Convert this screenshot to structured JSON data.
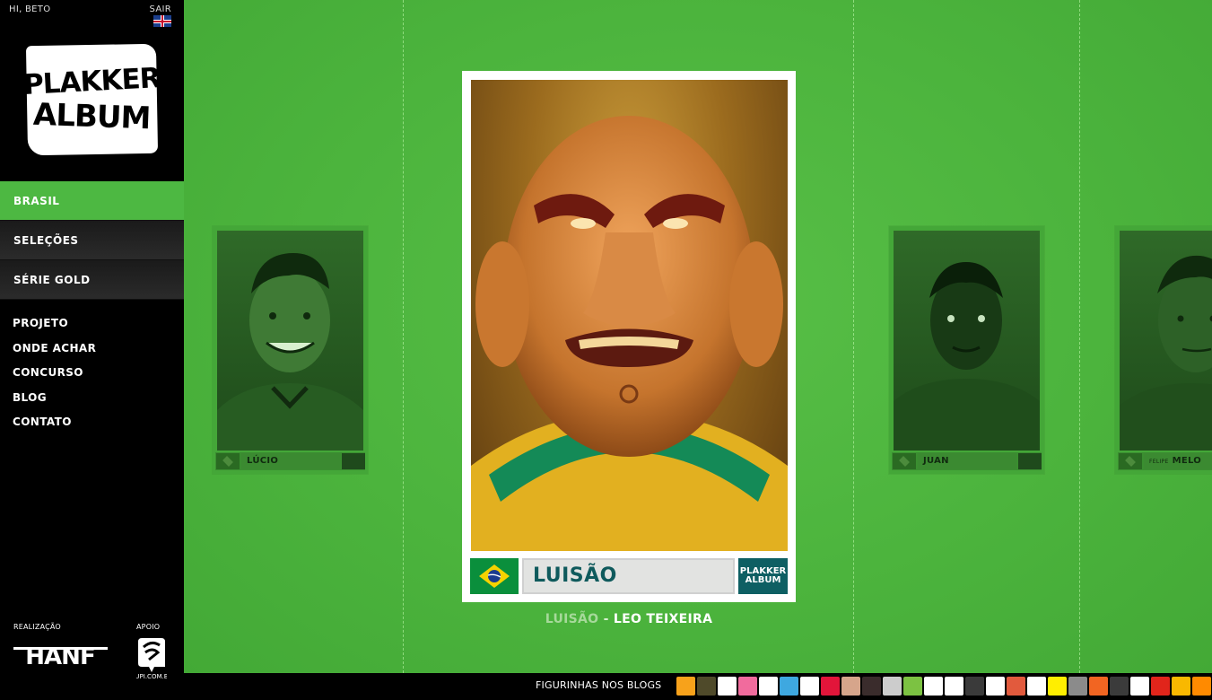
{
  "header": {
    "greeting": "HI, BETO",
    "logout": "SAIR"
  },
  "logo": {
    "line1": "PLAKKER",
    "line2": "ALBUM"
  },
  "main_menu": [
    {
      "label": "BRASIL",
      "active": true
    },
    {
      "label": "SELEÇÕES",
      "active": false
    },
    {
      "label": "SÉRIE GOLD",
      "active": false
    }
  ],
  "secondary_menu": [
    "PROJETO",
    "ONDE ACHAR",
    "CONCURSO",
    "BLOG",
    "CONTATO"
  ],
  "credits": {
    "made_by": "REALIZAÇÃO",
    "made_by_logo": "HANF",
    "support": "APOIO",
    "support_logo": "ZUPI.COM.BR"
  },
  "cards": {
    "left": {
      "name": "LÚCIO"
    },
    "center": {
      "name": "LUISÃO",
      "logo_l1": "PLAKKER",
      "logo_l2": "ALBUM"
    },
    "right1": {
      "name": "JUAN"
    },
    "right2": {
      "prefix": "FELIPE",
      "name": "MELO"
    }
  },
  "caption": {
    "player": "LUISÃO",
    "separator": " - ",
    "author": "LEO TEIXEIRA"
  },
  "footer": {
    "blogs_label": "FIGURINHAS NOS BLOGS"
  },
  "colors": {
    "accent_green": "#4db842",
    "stage_green": "#4cb43d",
    "card_teal": "#0e5f63",
    "name_text": "#0f5a5c"
  },
  "blog_icon_colors": [
    "#f7a21b",
    "#4f4a2a",
    "#ffffff",
    "#f16b9d",
    "#ffffff",
    "#3ea8e0",
    "#ffffff",
    "#e2153a",
    "#d6a58b",
    "#3a2c2c",
    "#cccccc",
    "#7cc242",
    "#ffffff",
    "#ffffff",
    "#3a3a3a",
    "#ffffff",
    "#e25a3d",
    "#ffffff",
    "#ffee00",
    "#8b8b8b",
    "#f26522",
    "#3b3b3b",
    "#ffffff",
    "#e1251b",
    "#f9b800",
    "#ff8a00"
  ]
}
